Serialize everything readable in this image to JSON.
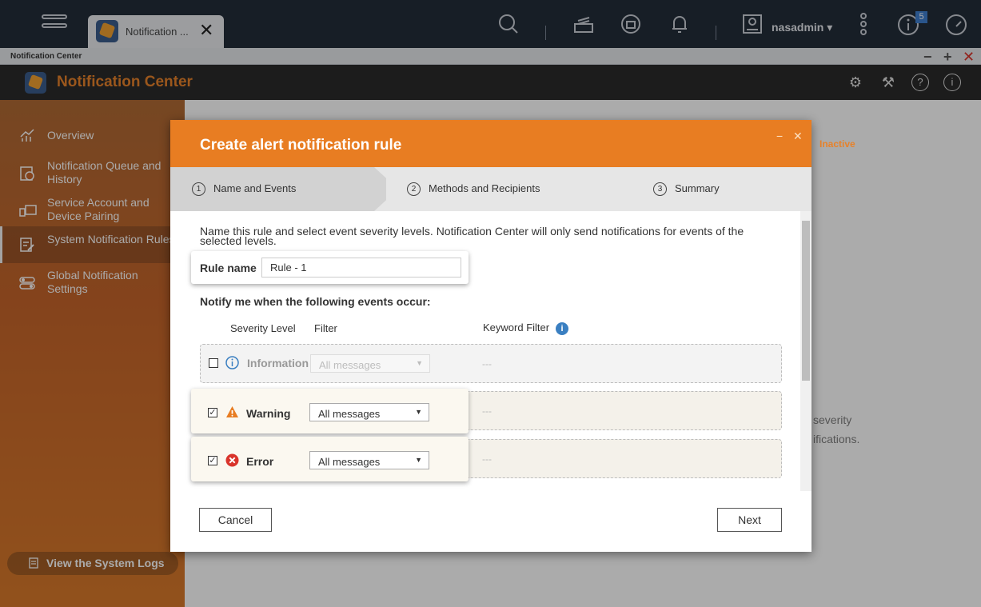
{
  "taskbar": {
    "tab_label": "Notification ...",
    "tab_close": "✕",
    "username": "nasadmin ▾",
    "badge": "5"
  },
  "window": {
    "title": "Notification Center",
    "controls": [
      "−",
      "+",
      "✕"
    ]
  },
  "app": {
    "title": "Notification Center"
  },
  "sidebar": {
    "items": [
      {
        "label": "Overview"
      },
      {
        "label": "Notification Queue and History"
      },
      {
        "label": "Service Account and Device Pairing"
      },
      {
        "label": "System Notification Rules"
      },
      {
        "label": "Global Notification Settings"
      }
    ],
    "logs_button": "View the System Logs"
  },
  "background": {
    "status": "Inactive",
    "text_line1": "severity",
    "text_line2": "ifications."
  },
  "dialog": {
    "title": "Create alert notification rule",
    "controls": [
      "−",
      "✕"
    ],
    "steps": [
      {
        "num": "1",
        "label": "Name and Events"
      },
      {
        "num": "2",
        "label": "Methods and Recipients"
      },
      {
        "num": "3",
        "label": "Summary"
      }
    ],
    "intro": "Name this rule and select event severity levels. Notification Center will only send notifications for events of the selected levels.",
    "rule_name_label": "Rule name",
    "rule_name_value": "Rule - 1",
    "notify_label": "Notify me when the following events occur:",
    "columns": {
      "severity": "Severity Level",
      "filter": "Filter",
      "keyword": "Keyword Filter"
    },
    "rows": [
      {
        "checked": "",
        "label": "Information",
        "filter": "All messages",
        "keyword": "---"
      },
      {
        "checked": "✓",
        "label": "Warning",
        "filter": "All messages",
        "keyword": "---"
      },
      {
        "checked": "✓",
        "label": "Error",
        "filter": "All messages",
        "keyword": "---"
      }
    ],
    "cancel": "Cancel",
    "next": "Next"
  },
  "colors": {
    "accent": "#e87d22",
    "warning": "#e87d22",
    "error": "#d9342b",
    "info": "#3a7fc1"
  }
}
